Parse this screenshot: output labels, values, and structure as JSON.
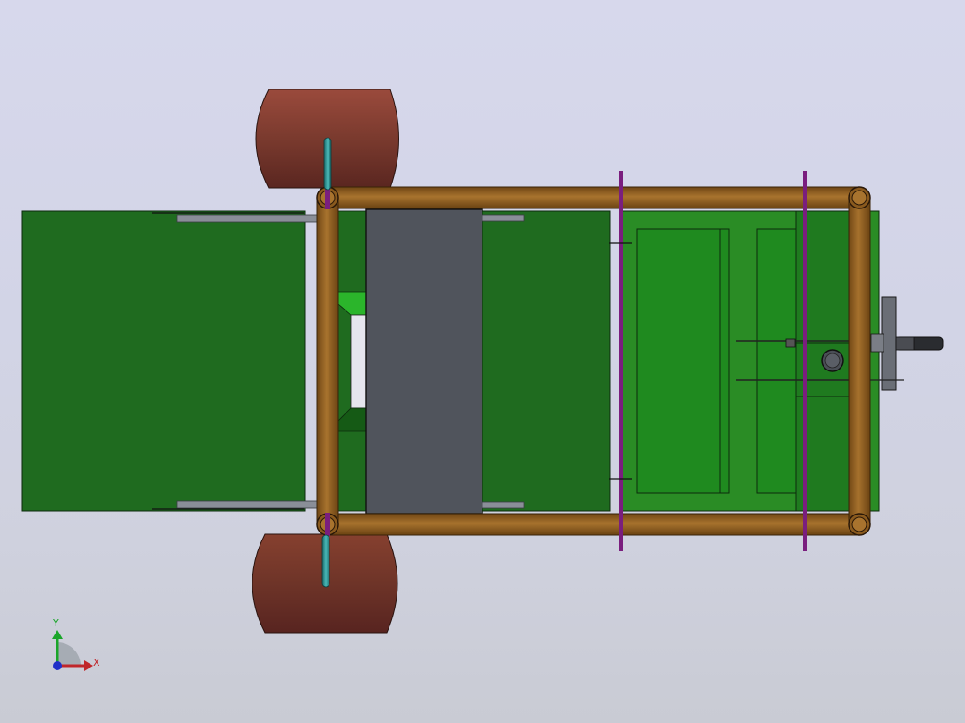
{
  "viewport": {
    "colors": {
      "background_top": "#d7d8ec",
      "background_bottom": "#c9cbd4",
      "panel_green_dark": "#1f6b1f",
      "panel_green_light": "#2a8c25",
      "frame_tube": "#8a5a1e",
      "wheel": "#7d3a30",
      "belt": "#50545c",
      "rod": "#7a1e7e"
    }
  },
  "triad": {
    "y_label": "Y",
    "x_label": "X",
    "colors": {
      "x": "#c0262a",
      "y": "#1aa52a",
      "z": "#2030c8"
    }
  }
}
